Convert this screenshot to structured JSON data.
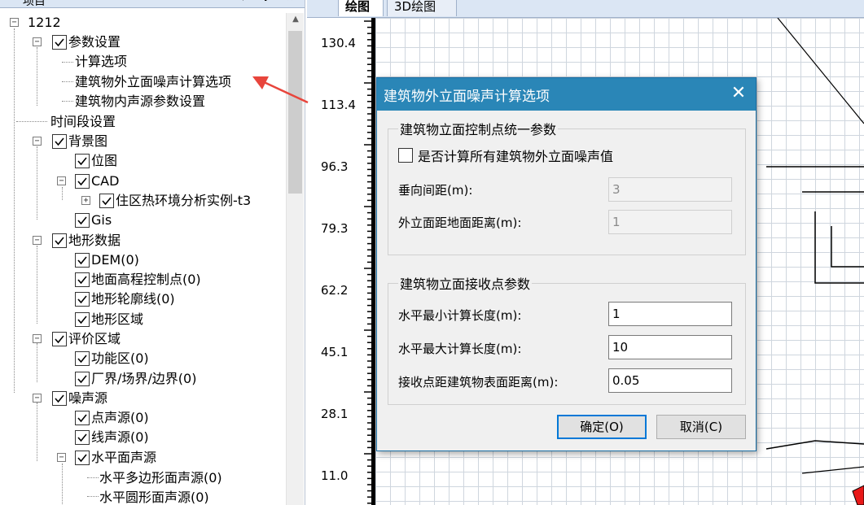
{
  "panel": {
    "title": "项目",
    "controls": "▾ ✚ ✕"
  },
  "tree": {
    "root": "1212",
    "params": "参数设置",
    "calc_options": "计算选项",
    "facade_options": "建筑物外立面噪声计算选项",
    "indoor_params": "建筑物内声源参数设置",
    "time_period": "时间段设置",
    "background": "背景图",
    "bitmap": "位图",
    "cad": "CAD",
    "cad_file": "住区热环境分析实例-t3",
    "gis": "Gis",
    "terrain": "地形数据",
    "dem": "DEM(0)",
    "ground_points": "地面高程控制点(0)",
    "contours": "地形轮廓线(0)",
    "terrain_region": "地形区域",
    "eval_area": "评价区域",
    "functional_zone": "功能区(0)",
    "boundary": "厂界/场界/边界(0)",
    "noise_source": "噪声源",
    "point_source": "点声源(0)",
    "line_source": "线声源(0)",
    "area_source": "水平面声源",
    "polygon_source": "水平多边形面声源(0)",
    "circle_source": "水平圆形面声源(0)"
  },
  "tabs": {
    "draw": "绘图",
    "view3d": "3D绘图"
  },
  "axis": {
    "ticks": [
      "130.4",
      "113.4",
      "96.3",
      "79.3",
      "62.2",
      "45.1",
      "28.1",
      "11.0"
    ]
  },
  "dialog": {
    "title": "建筑物外立面噪声计算选项",
    "close": "✕",
    "group1": {
      "legend": "建筑物立面控制点统一参数",
      "checkbox_label": "是否计算所有建筑物外立面噪声值",
      "vertical_spacing_label": "垂向间距(m):",
      "vertical_spacing_value": "3",
      "facade_height_label": "外立面距地面距离(m):",
      "facade_height_value": "1"
    },
    "group2": {
      "legend": "建筑物立面接收点参数",
      "min_length_label": "水平最小计算长度(m):",
      "min_length_value": "1",
      "max_length_label": "水平最大计算长度(m):",
      "max_length_value": "10",
      "distance_label": "接收点距建筑物表面距离(m):",
      "distance_value": "0.05"
    },
    "ok_label": "确定(O)",
    "cancel_label": "取消(C)"
  },
  "colors": {
    "dialog_title_bar": "#2a86b7",
    "annotation_arrow": "#e8453c",
    "marker": "#e81818"
  },
  "icons": {
    "checkbox": "check-icon",
    "expand": "plus-box-icon",
    "collapse": "minus-box-icon"
  }
}
